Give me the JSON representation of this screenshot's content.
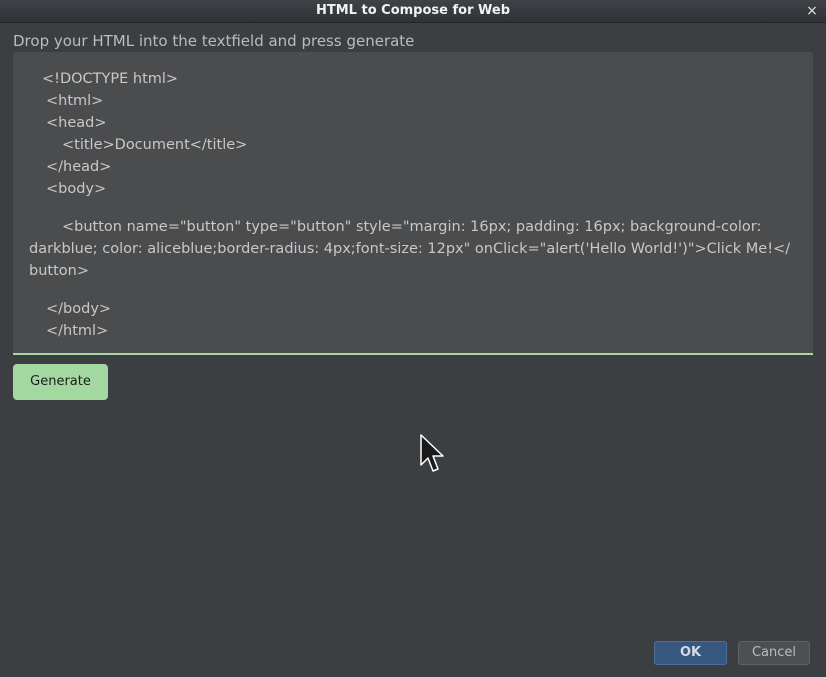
{
  "window": {
    "title": "HTML to Compose for Web",
    "close_glyph": "×"
  },
  "main": {
    "instruction": "Drop your HTML into the textfield and press generate",
    "editor": {
      "lines": [
        "<!DOCTYPE html>",
        "<html>",
        "<head>",
        "<title>Document</title>",
        "</head>",
        "<body>",
        "<button name=\"button\" type=\"button\" style=\"margin: 16px; padding: 16px; background-color:",
        "darkblue; color: aliceblue;border-radius: 4px;font-size: 12px\" onClick=\"alert('Hello World!')\">Click Me!</",
        "button>",
        "</body>",
        "</html>"
      ]
    },
    "generate_label": "Generate"
  },
  "footer": {
    "ok_label": "OK",
    "cancel_label": "Cancel"
  },
  "colors": {
    "accent_green": "#a3d8a0",
    "primary_blue": "#365880",
    "background": "#3c3f41",
    "editor_background": "#4b4c4e"
  }
}
